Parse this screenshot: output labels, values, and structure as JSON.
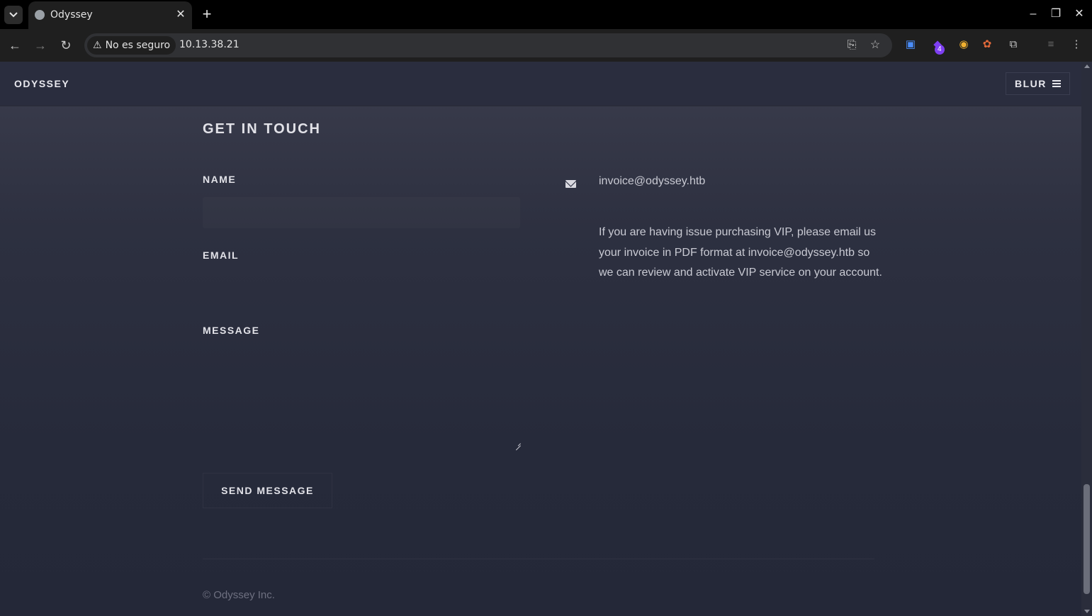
{
  "browser": {
    "tab_title": "Odyssey",
    "security_label": "No es seguro",
    "url": "10.13.38.21",
    "extension_badge": "4"
  },
  "site": {
    "brand": "ODYSSEY",
    "menu_label": "BLUR"
  },
  "contact": {
    "title": "GET IN TOUCH",
    "name_label": "NAME",
    "email_label": "EMAIL",
    "message_label": "MESSAGE",
    "send_label": "SEND MESSAGE",
    "email": "invoice@odyssey.htb",
    "note": "If you are having issue purchasing VIP, please email us your invoice in PDF format at invoice@odyssey.htb so we can review and activate VIP service on your account."
  },
  "footer": {
    "copyright": "© Odyssey Inc."
  }
}
